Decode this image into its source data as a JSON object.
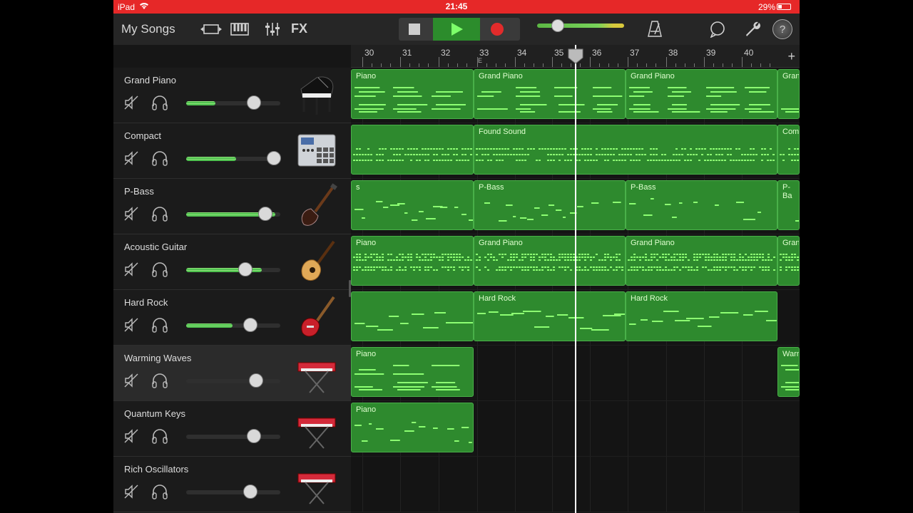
{
  "status": {
    "device": "iPad",
    "time": "21:45",
    "battery": "29%"
  },
  "toolbar": {
    "my_songs": "My Songs",
    "fx": "FX"
  },
  "ruler": {
    "bars": [
      "30",
      "31",
      "32",
      "33",
      "34",
      "35",
      "36",
      "37",
      "38",
      "39",
      "40"
    ],
    "marker": "E"
  },
  "tracks": [
    {
      "name": "Grand Piano",
      "volume": 0.72,
      "level": 0.31,
      "selected": false,
      "instrument": "grand-piano-icon"
    },
    {
      "name": "Compact",
      "volume": 0.93,
      "level": 0.53,
      "selected": false,
      "instrument": "drum-machine-icon"
    },
    {
      "name": "P-Bass",
      "volume": 0.84,
      "level": 0.95,
      "selected": false,
      "instrument": "bass-guitar-icon"
    },
    {
      "name": "Acoustic Guitar",
      "volume": 0.63,
      "level": 0.8,
      "selected": false,
      "instrument": "acoustic-guitar-icon"
    },
    {
      "name": "Hard Rock",
      "volume": 0.68,
      "level": 0.49,
      "selected": false,
      "instrument": "electric-guitar-icon"
    },
    {
      "name": "Warming Waves",
      "volume": 0.74,
      "level": 0.0,
      "selected": true,
      "instrument": "synth-keyboard-icon"
    },
    {
      "name": "Quantum Keys",
      "volume": 0.72,
      "level": 0.0,
      "selected": false,
      "instrument": "synth-keyboard-icon"
    },
    {
      "name": "Rich Oscillators",
      "volume": 0.68,
      "level": 0.0,
      "selected": false,
      "instrument": "synth-keyboard-icon"
    }
  ],
  "regions": [
    [
      {
        "label": "Piano"
      },
      {
        "label": "Grand Piano"
      },
      {
        "label": "Grand Piano"
      },
      {
        "label": "Gran"
      }
    ],
    [
      {
        "label": ""
      },
      {
        "label": "Found Sound"
      },
      {
        "label": "Com"
      }
    ],
    [
      {
        "label": "s"
      },
      {
        "label": "P-Bass"
      },
      {
        "label": "P-Bass"
      },
      {
        "label": "P-Ba"
      }
    ],
    [
      {
        "label": "Piano"
      },
      {
        "label": "Grand Piano"
      },
      {
        "label": "Grand Piano"
      },
      {
        "label": "Gran"
      }
    ],
    [
      {
        "label": ""
      },
      {
        "label": "Hard Rock"
      },
      {
        "label": "Hard Rock"
      }
    ],
    [
      {
        "label": "Piano"
      },
      {
        "label": "Warn"
      }
    ],
    [
      {
        "label": "Piano"
      }
    ],
    []
  ],
  "colors": {
    "status_bar": "#e62828",
    "region_green": "#2e8a2e",
    "note_green": "#7dff6a",
    "play_green": "#2c8c2c",
    "record_red": "#e22b2b"
  }
}
